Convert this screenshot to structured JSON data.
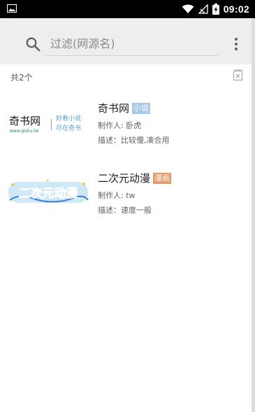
{
  "status_bar": {
    "time": "09:02",
    "icons": [
      "image-icon",
      "wifi-icon",
      "no-signal-icon",
      "battery-charging-icon"
    ]
  },
  "search": {
    "placeholder": "过滤(网源名)",
    "value": "",
    "icon": "search-icon",
    "menu_icon": "more-vertical-icon"
  },
  "summary": {
    "count_label": "共2个",
    "clear_icon": "clear-list-icon"
  },
  "sources": [
    {
      "name": "奇书网",
      "tag": "小说",
      "maker": "制作人: 卧虎",
      "description": "描述：比较慢,凑合用",
      "logo": {
        "main": "奇书网",
        "sub": "www.qishu.tw",
        "slogan_line1": "好看小说",
        "slogan_line2": "尽在奇书"
      }
    },
    {
      "name": "二次元动漫",
      "tag": "漫画",
      "maker": "制作人: tw",
      "description": "描述：速度一般",
      "logo": {
        "main": "二次元动漫"
      }
    }
  ]
}
